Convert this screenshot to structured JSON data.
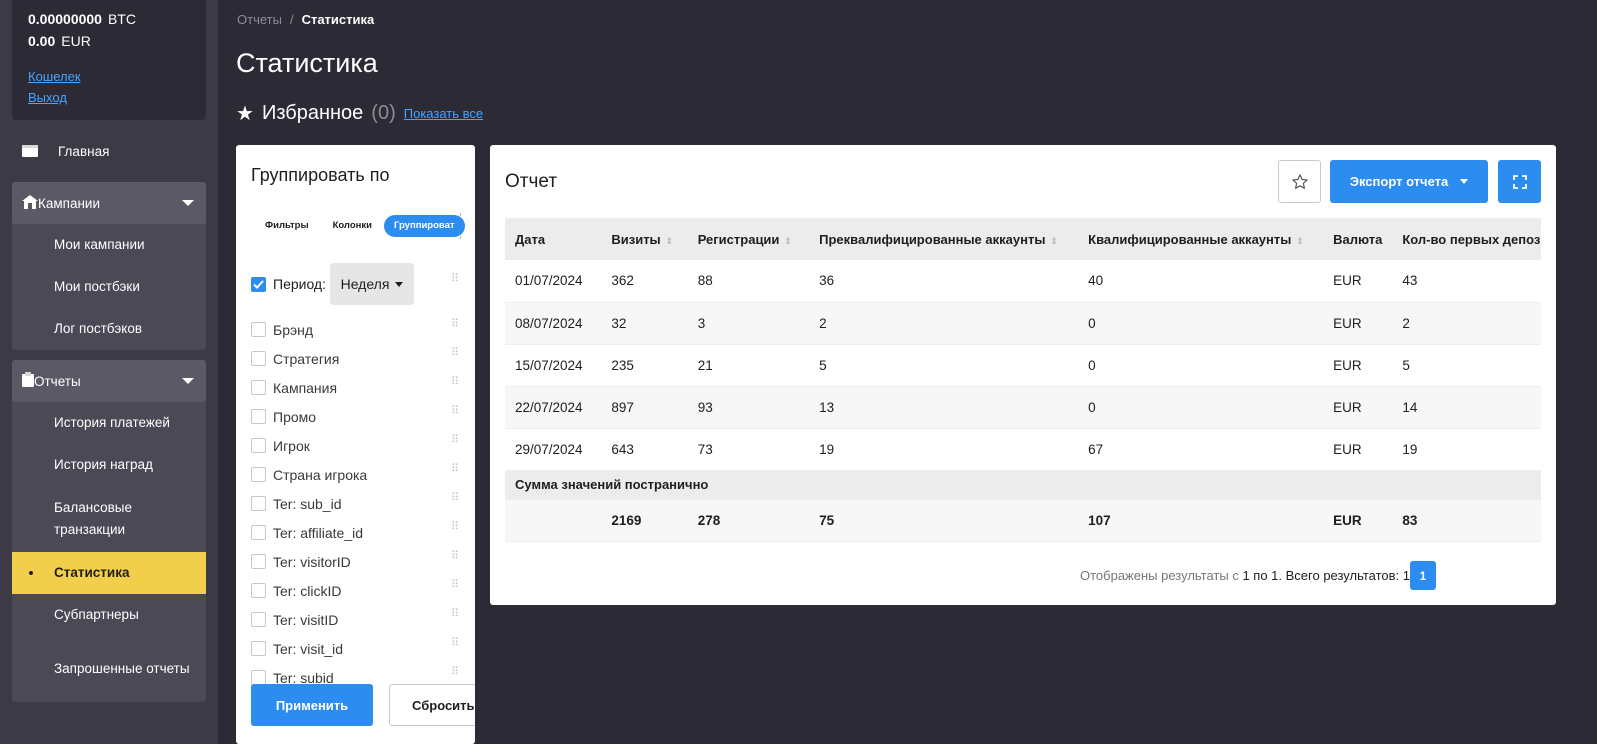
{
  "wallet": {
    "btc_amount": "0.00000000",
    "btc_currency": "BTC",
    "eur_amount": "0.00",
    "eur_currency": "EUR",
    "wallet_link": "Кошелек",
    "logout_link": "Выход"
  },
  "nav": {
    "home": "Главная",
    "campaigns": {
      "label": "Кампании",
      "items": [
        "Мои кампании",
        "Мои постбэки",
        "Лог постбэков"
      ]
    },
    "reports": {
      "label": "Отчеты",
      "items": [
        "История платежей",
        "История наград",
        "Балансовые транзакции",
        "Статистика",
        "Субпартнеры",
        "Запрошенные отчеты"
      ]
    }
  },
  "breadcrumb": {
    "parent": "Отчеты",
    "separator": "/",
    "current": "Статистика"
  },
  "page_title": "Статистика",
  "favorites": {
    "label": "Избранное",
    "count": "(0)",
    "show_all": "Показать все"
  },
  "group_panel": {
    "title": "Группировать по",
    "tabs": [
      "Фильтры",
      "Колонки",
      "Группироват"
    ],
    "period_label": "Период:",
    "period_value": "Неделя",
    "options": [
      "Брэнд",
      "Стратегия",
      "Кампания",
      "Промо",
      "Игрок",
      "Страна игрока",
      "Ter: sub_id",
      "Ter: affiliate_id",
      "Ter: visitorID",
      "Ter: clickID",
      "Ter: visitID",
      "Ter: visit_id",
      "Ter: subid"
    ],
    "apply": "Применить",
    "reset": "Сбросить"
  },
  "report": {
    "title": "Отчет",
    "export": "Экспорт отчета",
    "columns": [
      "Дата",
      "Визиты",
      "Регистрации",
      "Преквалифицированные аккаунты",
      "Квалифицированные аккаунты",
      "Валюта",
      "Кол-во первых депоз"
    ],
    "rows": [
      [
        "01/07/2024",
        "362",
        "88",
        "36",
        "40",
        "EUR",
        "43"
      ],
      [
        "08/07/2024",
        "32",
        "3",
        "2",
        "0",
        "EUR",
        "2"
      ],
      [
        "15/07/2024",
        "235",
        "21",
        "5",
        "0",
        "EUR",
        "5"
      ],
      [
        "22/07/2024",
        "897",
        "93",
        "13",
        "0",
        "EUR",
        "14"
      ],
      [
        "29/07/2024",
        "643",
        "73",
        "19",
        "67",
        "EUR",
        "19"
      ]
    ],
    "summary_label": "Сумма значений постранично",
    "summary": [
      "",
      "2169",
      "278",
      "75",
      "107",
      "EUR",
      "83"
    ],
    "pager": {
      "text_prefix": "Отображены результаты с ",
      "text_range": "1 по 1. Всего результатов: 1",
      "current_page": "1"
    }
  }
}
